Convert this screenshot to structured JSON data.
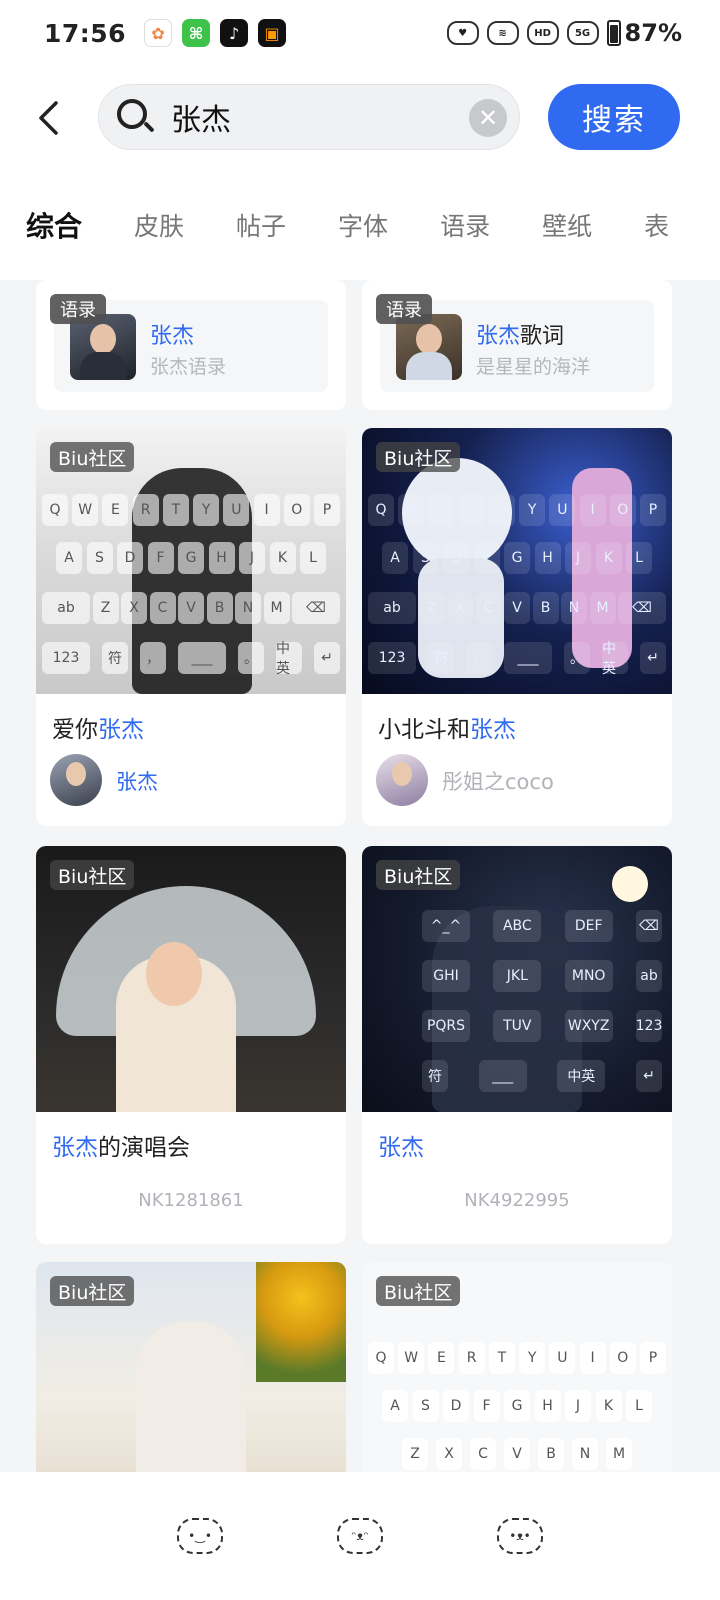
{
  "status_bar": {
    "time": "17:56",
    "battery": "87%",
    "network": "5G",
    "app_icons": [
      "photos-icon",
      "maps-icon",
      "tiktok-icon",
      "reader-icon"
    ]
  },
  "search": {
    "query": "张杰",
    "button_label": "搜索"
  },
  "tabs": [
    {
      "label": "综合",
      "active": true
    },
    {
      "label": "皮肤",
      "active": false
    },
    {
      "label": "帖子",
      "active": false
    },
    {
      "label": "字体",
      "active": false
    },
    {
      "label": "语录",
      "active": false
    },
    {
      "label": "壁纸",
      "active": false
    },
    {
      "label": "表",
      "active": false
    }
  ],
  "quotes": [
    {
      "tag": "语录",
      "title_highlight": "张杰",
      "title_rest": "",
      "subtitle": "张杰语录"
    },
    {
      "tag": "语录",
      "title_highlight": "张杰",
      "title_rest": "歌词",
      "subtitle": "是星星的海洋"
    }
  ],
  "posts": [
    {
      "badge": "Biu社区",
      "title_prefix": "爱你",
      "title_highlight": "张杰",
      "title_suffix": "",
      "author": "张杰",
      "author_highlight": true
    },
    {
      "badge": "Biu社区",
      "title_prefix": "小北斗和",
      "title_highlight": "张杰",
      "title_suffix": "",
      "author": "彤姐之coco",
      "author_highlight": false
    },
    {
      "badge": "Biu社区",
      "title_prefix": "",
      "title_highlight": "张杰",
      "title_suffix": "的演唱会",
      "id": "NK1281861"
    },
    {
      "badge": "Biu社区",
      "title_prefix": "",
      "title_highlight": "张杰",
      "title_suffix": "",
      "id": "NK4922995"
    },
    {
      "badge": "Biu社区"
    },
    {
      "badge": "Biu社区"
    }
  ],
  "keys": {
    "row1": [
      "Q",
      "W",
      "E",
      "R",
      "T",
      "Y",
      "U",
      "I",
      "O",
      "P"
    ],
    "row2": [
      "A",
      "S",
      "D",
      "F",
      "G",
      "H",
      "J",
      "K",
      "L"
    ],
    "row3": [
      "ab",
      "Z",
      "X",
      "C",
      "V",
      "B",
      "N",
      "M",
      "⌫"
    ],
    "row4": [
      "123",
      "符",
      "，",
      "___",
      "。",
      "中英",
      "↵"
    ],
    "t9_row1": [
      "^_^",
      "ABC",
      "DEF",
      "⌫"
    ],
    "t9_row2": [
      "GHI",
      "JKL",
      "MNO",
      "ab"
    ],
    "t9_row3": [
      "PQRS",
      "TUV",
      "WXYZ",
      "123"
    ],
    "t9_row4": [
      "符",
      "___",
      "中英",
      "↵"
    ]
  },
  "colors": {
    "accent": "#2f6af0"
  }
}
